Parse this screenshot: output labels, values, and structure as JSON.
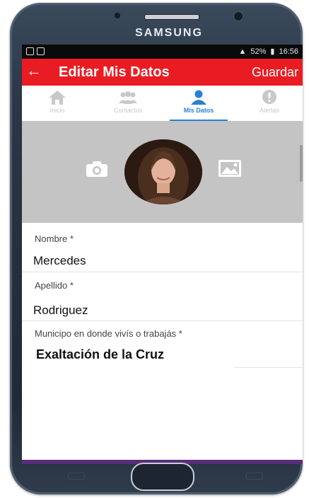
{
  "device": {
    "brand": "SAMSUNG"
  },
  "status_bar": {
    "battery": "52%",
    "time": "16:56"
  },
  "app_bar": {
    "back_icon": "arrow-left-icon",
    "title": "Editar Mis Datos",
    "action": "Guardar"
  },
  "tabs": [
    {
      "label": "Inicio",
      "icon": "home-icon",
      "active": false
    },
    {
      "label": "Contactos",
      "icon": "contacts-icon",
      "active": false
    },
    {
      "label": "Mis Datos",
      "icon": "person-icon",
      "active": true
    },
    {
      "label": "Alertas",
      "icon": "alert-icon",
      "active": false
    }
  ],
  "profile": {
    "camera_icon": "camera-icon",
    "gallery_icon": "gallery-icon"
  },
  "form": {
    "fields": [
      {
        "label": "Nombre *",
        "value": "Mercedes"
      },
      {
        "label": "Apellido *",
        "value": "Rodriguez"
      },
      {
        "label": "Municipo en donde vivís o trabajás *",
        "value": "Exaltación de la Cruz"
      }
    ]
  },
  "colors": {
    "accent": "#ea1c23",
    "tab_active": "#2a7fd4",
    "photo_bg": "#c4c4c4"
  }
}
